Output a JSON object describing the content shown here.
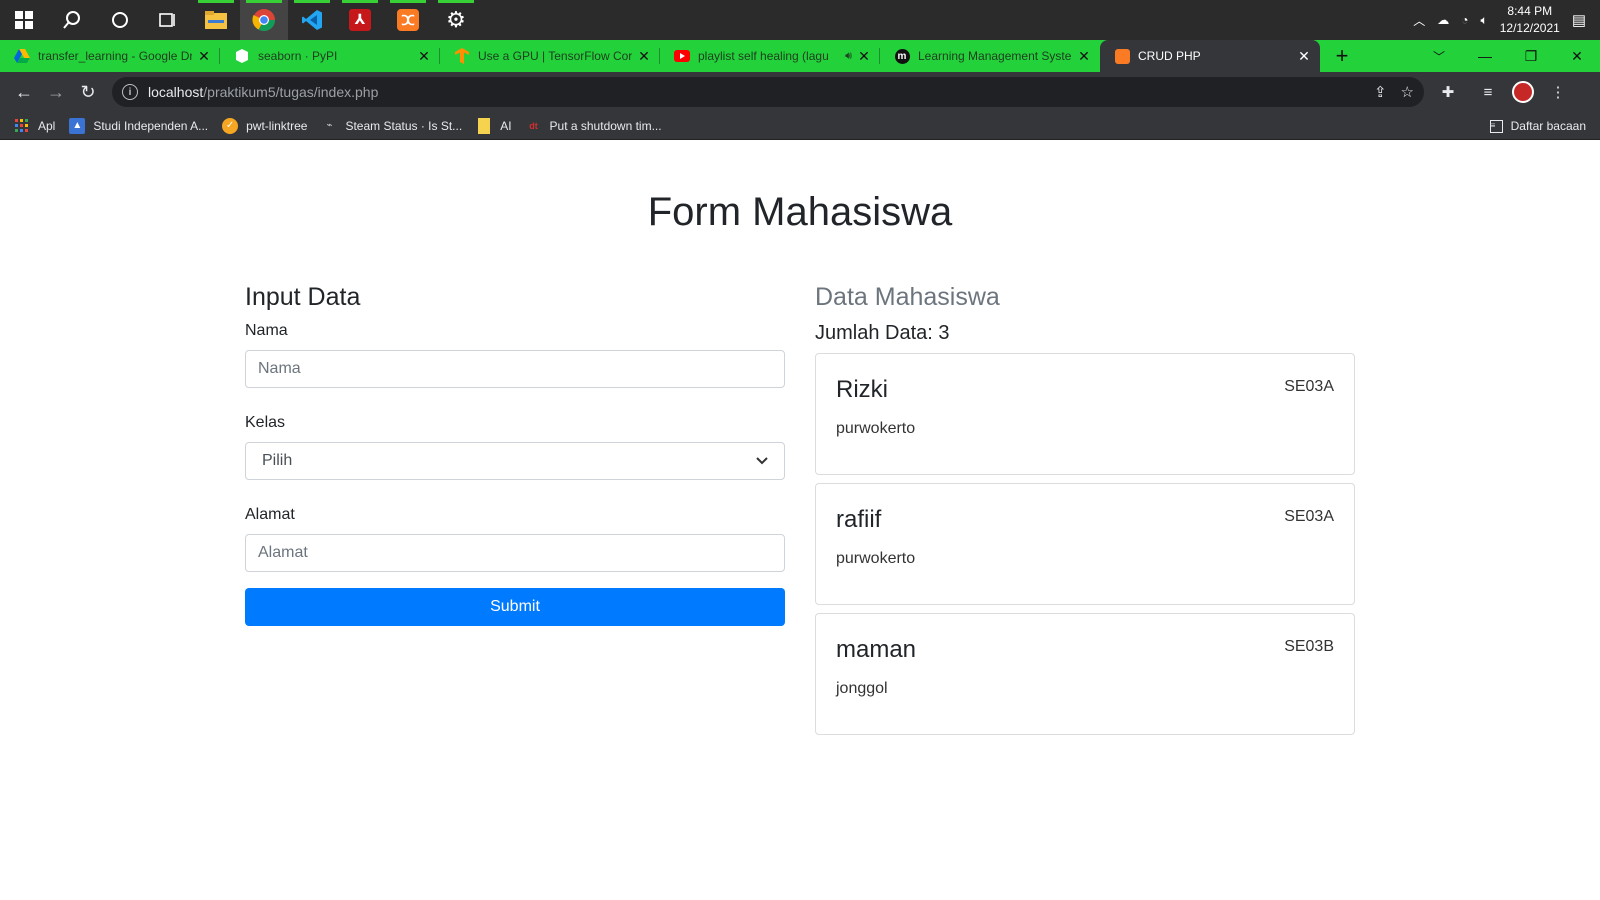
{
  "taskbar": {
    "icons": [
      "windows-start-icon",
      "search-icon",
      "cortana-icon",
      "task-view-icon",
      "file-explorer-icon",
      "chrome-icon",
      "vscode-icon",
      "acrobat-icon",
      "xampp-icon",
      "settings-icon"
    ],
    "time": "8:44 PM",
    "date": "12/12/2021"
  },
  "tabs": [
    {
      "title": "transfer_learning - Google Dri",
      "icon": "google-drive-icon"
    },
    {
      "title": "seaborn · PyPI",
      "icon": "pypi-icon"
    },
    {
      "title": "Use a GPU  |  TensorFlow Core",
      "icon": "tensorflow-icon"
    },
    {
      "title": "playlist self healing (lagu",
      "icon": "youtube-icon"
    },
    {
      "title": "Learning Management System",
      "icon": "moodle-icon"
    },
    {
      "title": "CRUD PHP",
      "icon": "xampp-icon"
    }
  ],
  "omnibox": {
    "host": "localhost",
    "path": "/praktikum5/tugas/index.php"
  },
  "bookmarks": [
    {
      "label": "Apl",
      "icon": "apps-grid-icon"
    },
    {
      "label": "Studi Independen A...",
      "icon": "bookmark-site-icon"
    },
    {
      "label": "pwt-linktree",
      "icon": "linktree-icon"
    },
    {
      "label": "Steam Status · Is St...",
      "icon": "steam-icon"
    },
    {
      "label": "AI",
      "icon": "folder-icon"
    },
    {
      "label": "Put a shutdown tim...",
      "icon": "bookmark-site-icon"
    }
  ],
  "reading_list": "Daftar bacaan",
  "page": {
    "title": "Form Mahasiswa",
    "form": {
      "heading": "Input Data",
      "nama_label": "Nama",
      "nama_placeholder": "Nama",
      "kelas_label": "Kelas",
      "kelas_selected": "Pilih",
      "alamat_label": "Alamat",
      "alamat_placeholder": "Alamat",
      "submit_label": "Submit"
    },
    "data": {
      "heading": "Data Mahasiswa",
      "count_label": "Jumlah Data: 3",
      "students": [
        {
          "nama": "Rizki",
          "kelas": "SE03A",
          "alamat": "purwokerto"
        },
        {
          "nama": "rafiif",
          "kelas": "SE03A",
          "alamat": "purwokerto"
        },
        {
          "nama": "maman",
          "kelas": "SE03B",
          "alamat": "jonggol"
        }
      ]
    }
  },
  "colors": {
    "tab_strip": "#23d23b",
    "chrome_dark": "#35363a",
    "primary_button": "#007bff"
  }
}
